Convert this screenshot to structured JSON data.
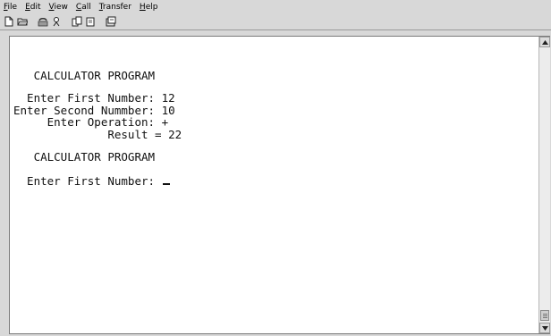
{
  "menu": {
    "items": [
      {
        "label": "File"
      },
      {
        "label": "Edit"
      },
      {
        "label": "View"
      },
      {
        "label": "Call"
      },
      {
        "label": "Transfer"
      },
      {
        "label": "Help"
      }
    ]
  },
  "toolbar": {
    "buttons": [
      {
        "icon": "new-document-icon"
      },
      {
        "icon": "open-folder-icon"
      },
      {
        "icon": "phone-icon"
      },
      {
        "icon": "disconnect-icon"
      },
      {
        "icon": "send-file-icon"
      },
      {
        "icon": "receive-file-icon"
      },
      {
        "icon": "properties-icon"
      }
    ]
  },
  "terminal": {
    "lines": [
      "   CALCULATOR PROGRAM",
      "  Enter First Number: 12",
      "Enter Second Nummber: 10",
      "     Enter Operation: +",
      "              Result = 22",
      "   CALCULATOR PROGRAM",
      "  Enter First Number: "
    ]
  }
}
